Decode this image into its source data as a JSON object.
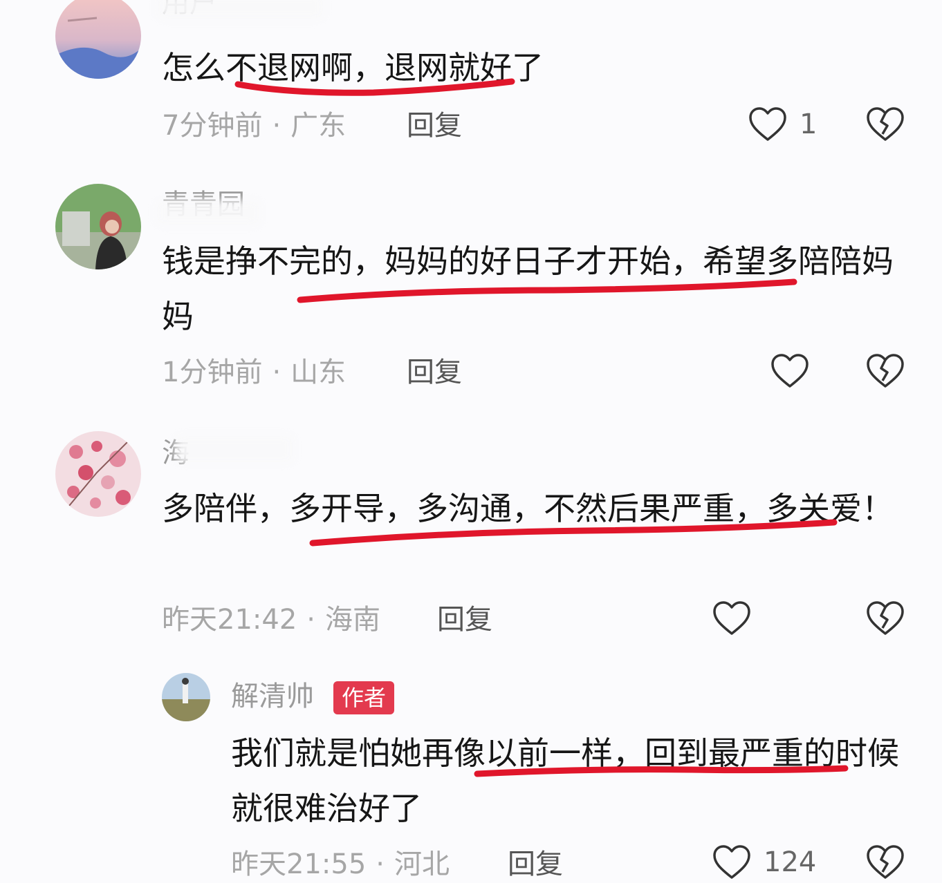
{
  "comments": [
    {
      "username": "用户",
      "text": "怎么不退网啊，退网就好了",
      "time": "7分钟前",
      "location": "广东",
      "reply_label": "回复",
      "likes": "1"
    },
    {
      "username": "青青园",
      "text": "钱是挣不完的，妈妈的好日子才开始，希望多陪陪妈妈",
      "time": "1分钟前",
      "location": "山东",
      "reply_label": "回复",
      "likes": ""
    },
    {
      "username": "海",
      "text": "多陪伴，多开导，多沟通，不然后果严重，多关爱！",
      "time": "昨天21:42",
      "location": "海南",
      "reply_label": "回复",
      "likes": ""
    }
  ],
  "author_reply": {
    "username": "解清帅",
    "badge": "作者",
    "text": "我们就是怕她再像以前一样，回到最严重的时候就很难治好了",
    "time": "昨天21:55",
    "location": "河北",
    "reply_label": "回复",
    "likes": "124"
  },
  "colors": {
    "underline": "#e0162b",
    "badge": "#e33a4e",
    "meta": "#a6a6a6"
  },
  "icons": [
    "heart-outline-icon",
    "broken-heart-icon"
  ]
}
